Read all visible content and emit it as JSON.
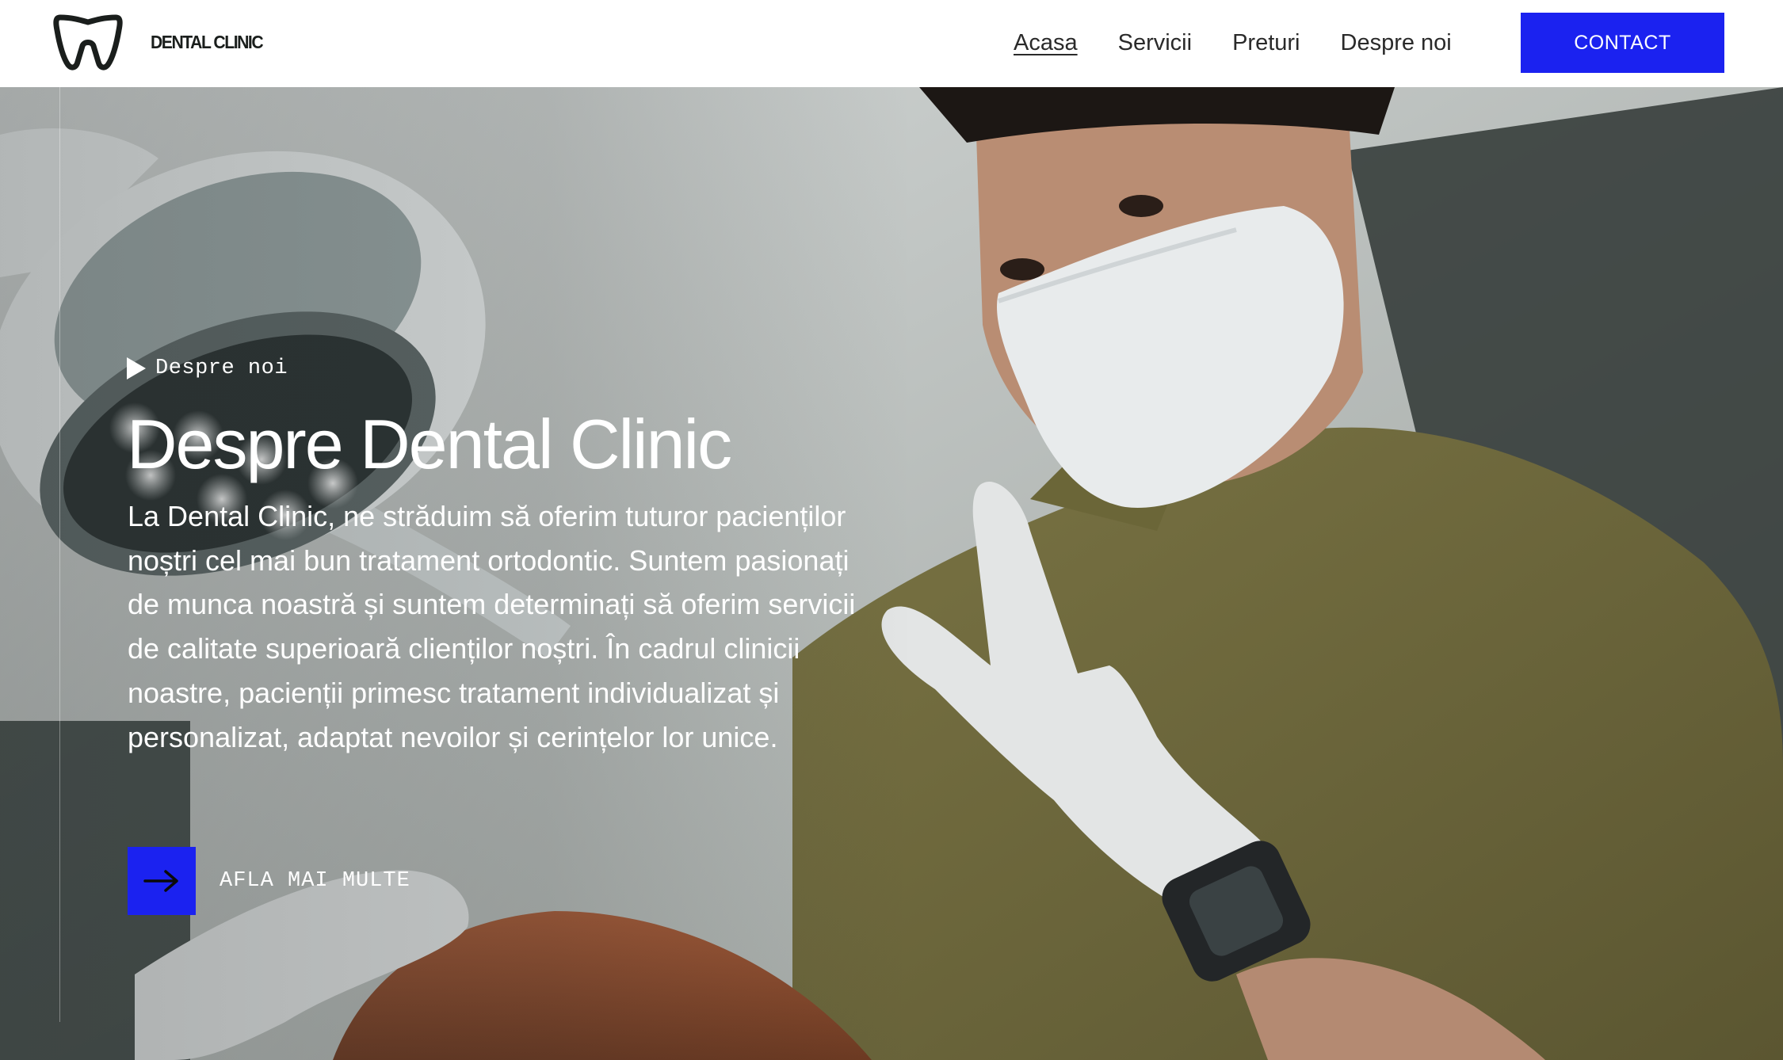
{
  "header": {
    "brand": "DENTAL CLINIC",
    "logo_icon": "tooth-icon",
    "nav": [
      {
        "label": "Acasa",
        "active": true
      },
      {
        "label": "Servicii",
        "active": false
      },
      {
        "label": "Preturi",
        "active": false
      },
      {
        "label": "Despre noi",
        "active": false
      }
    ],
    "contact_label": "CONTACT"
  },
  "hero": {
    "eyebrow": "Despre noi",
    "title": "Despre Dental Clinic",
    "description": "La Dental Clinic, ne străduim să oferim tuturor pacienților noștri cel mai bun tratament ortodontic. Suntem pasionați de munca noastră și suntem determinați să oferim servicii de calitate superioară clienților noștri. În cadrul clinicii noastre, pacienții primesc tratament individualizat și personalizat, adaptat nevoilor și cerințelor lor unice.",
    "cta_label": "AFLA MAI MULTE",
    "cta_icon": "arrow-right-icon",
    "background_image": "dentist-with-mask-and-gloves-photo"
  },
  "colors": {
    "accent": "#1b22f0",
    "text_dark": "#2a2a2a",
    "header_bg": "#ffffff"
  }
}
